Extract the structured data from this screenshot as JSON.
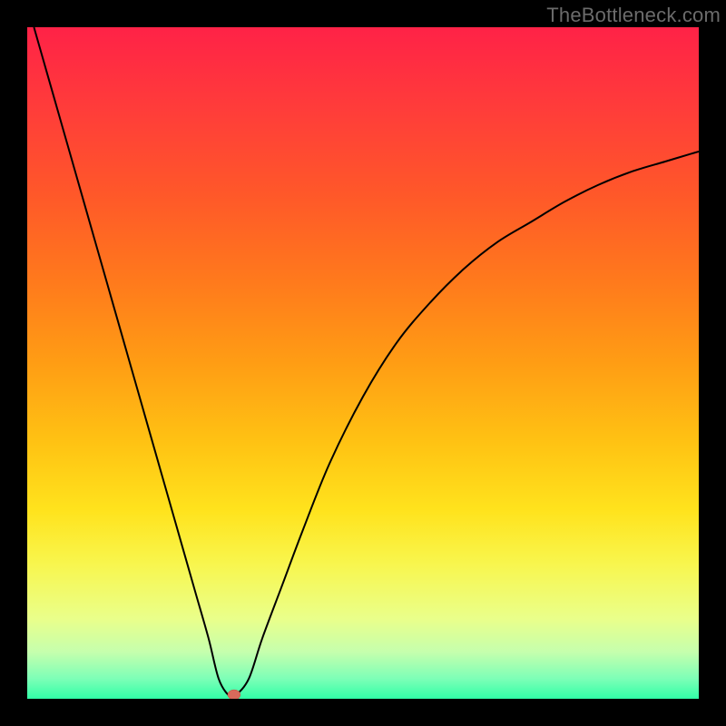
{
  "watermark": "TheBottleneck.com",
  "colors": {
    "accent_dot": "#d86a5b",
    "curve": "#000000",
    "frame": "#000000"
  },
  "gradient_stops": [
    {
      "offset": 0.0,
      "color": "#ff2247"
    },
    {
      "offset": 0.12,
      "color": "#ff3c3a"
    },
    {
      "offset": 0.25,
      "color": "#ff5829"
    },
    {
      "offset": 0.38,
      "color": "#ff7a1c"
    },
    {
      "offset": 0.5,
      "color": "#ff9d14"
    },
    {
      "offset": 0.62,
      "color": "#ffc313"
    },
    {
      "offset": 0.72,
      "color": "#ffe31d"
    },
    {
      "offset": 0.8,
      "color": "#f8f64e"
    },
    {
      "offset": 0.88,
      "color": "#eaff8a"
    },
    {
      "offset": 0.93,
      "color": "#c6ffad"
    },
    {
      "offset": 0.97,
      "color": "#7dffb7"
    },
    {
      "offset": 1.0,
      "color": "#31ffa7"
    }
  ],
  "chart_data": {
    "type": "line",
    "title": "",
    "xlabel": "",
    "ylabel": "",
    "xlim": [
      0,
      100
    ],
    "ylim": [
      0,
      100
    ],
    "grid": false,
    "series": [
      {
        "name": "bottleneck-curve",
        "x": [
          1,
          3,
          5,
          7,
          9,
          11,
          13,
          15,
          17,
          19,
          21,
          23,
          25,
          27,
          28.5,
          30,
          31,
          33,
          35,
          38,
          41,
          45,
          50,
          55,
          60,
          65,
          70,
          75,
          80,
          85,
          90,
          95,
          100
        ],
        "y": [
          100,
          93,
          86,
          79,
          72,
          65,
          58,
          51,
          44,
          37,
          30,
          23,
          16,
          9,
          3,
          0.5,
          0.5,
          3,
          9,
          17,
          25,
          35,
          45,
          53,
          59,
          64,
          68,
          71,
          74,
          76.5,
          78.5,
          80,
          81.5
        ]
      }
    ],
    "annotations": [
      {
        "name": "minimum-dot",
        "x": 30.8,
        "y": 0.6
      }
    ]
  }
}
